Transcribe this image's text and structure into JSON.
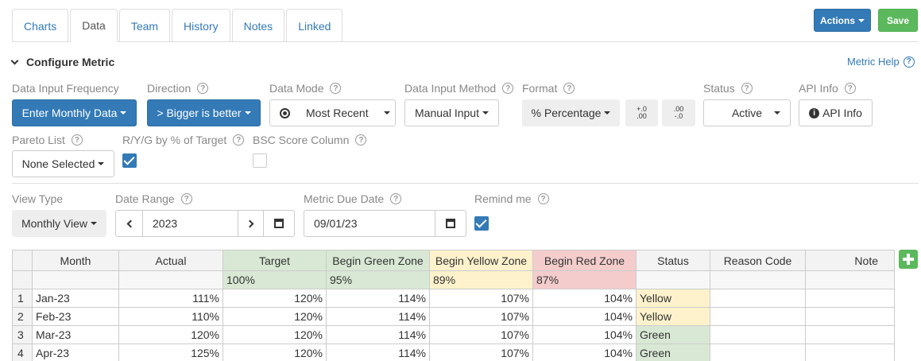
{
  "tabs": [
    {
      "label": "Charts"
    },
    {
      "label": "Data"
    },
    {
      "label": "Team"
    },
    {
      "label": "History"
    },
    {
      "label": "Notes"
    },
    {
      "label": "Linked"
    }
  ],
  "header": {
    "actions_label": "Actions",
    "save_label": "Save"
  },
  "section": {
    "title": "Configure Metric",
    "help_link": "Metric Help"
  },
  "fields": {
    "frequency": {
      "label": "Data Input Frequency",
      "value": "Enter Monthly Data"
    },
    "direction": {
      "label": "Direction",
      "value": "> Bigger is better"
    },
    "mode": {
      "label": "Data Mode",
      "value": "Most Recent"
    },
    "method": {
      "label": "Data Input Method",
      "value": "Manual Input"
    },
    "format": {
      "label": "Format",
      "value": "% Percentage"
    },
    "status": {
      "label": "Status",
      "value": "Active"
    },
    "api": {
      "label": "API Info",
      "button": "API Info"
    },
    "pareto": {
      "label": "Pareto List",
      "value": "None Selected"
    },
    "ryg": {
      "label": "R/Y/G by % of Target",
      "checked": true
    },
    "bsc": {
      "label": "BSC Score Column",
      "checked": false
    },
    "view_type": {
      "label": "View Type",
      "value": "Monthly View"
    },
    "date_range": {
      "label": "Date Range",
      "value": "2023"
    },
    "due_date": {
      "label": "Metric Due Date",
      "value": "09/01/23"
    },
    "remind": {
      "label": "Remind me",
      "checked": true
    }
  },
  "grid": {
    "columns": [
      "Month",
      "Actual",
      "Target",
      "Begin Green Zone",
      "Begin Yellow Zone",
      "Begin Red Zone",
      "Status",
      "Reason Code",
      "Note"
    ],
    "percent_row": [
      "",
      "",
      "100%",
      "95%",
      "89%",
      "87%",
      "",
      "",
      ""
    ],
    "rows": [
      {
        "num": "1",
        "month": "Jan-23",
        "actual": "111%",
        "target": "120%",
        "green": "114%",
        "yellow": "107%",
        "red": "104%",
        "status": "Yellow"
      },
      {
        "num": "2",
        "month": "Feb-23",
        "actual": "110%",
        "target": "120%",
        "green": "114%",
        "yellow": "107%",
        "red": "104%",
        "status": "Yellow"
      },
      {
        "num": "3",
        "month": "Mar-23",
        "actual": "120%",
        "target": "120%",
        "green": "114%",
        "yellow": "107%",
        "red": "104%",
        "status": "Green"
      },
      {
        "num": "4",
        "month": "Apr-23",
        "actual": "125%",
        "target": "120%",
        "green": "114%",
        "yellow": "107%",
        "red": "104%",
        "status": "Green"
      }
    ]
  },
  "colors": {
    "primary": "#337ab7",
    "success": "#5cb85c",
    "zone_green": "#d8e8d4",
    "zone_yellow": "#fdf2cc",
    "zone_red": "#f4cccc"
  }
}
